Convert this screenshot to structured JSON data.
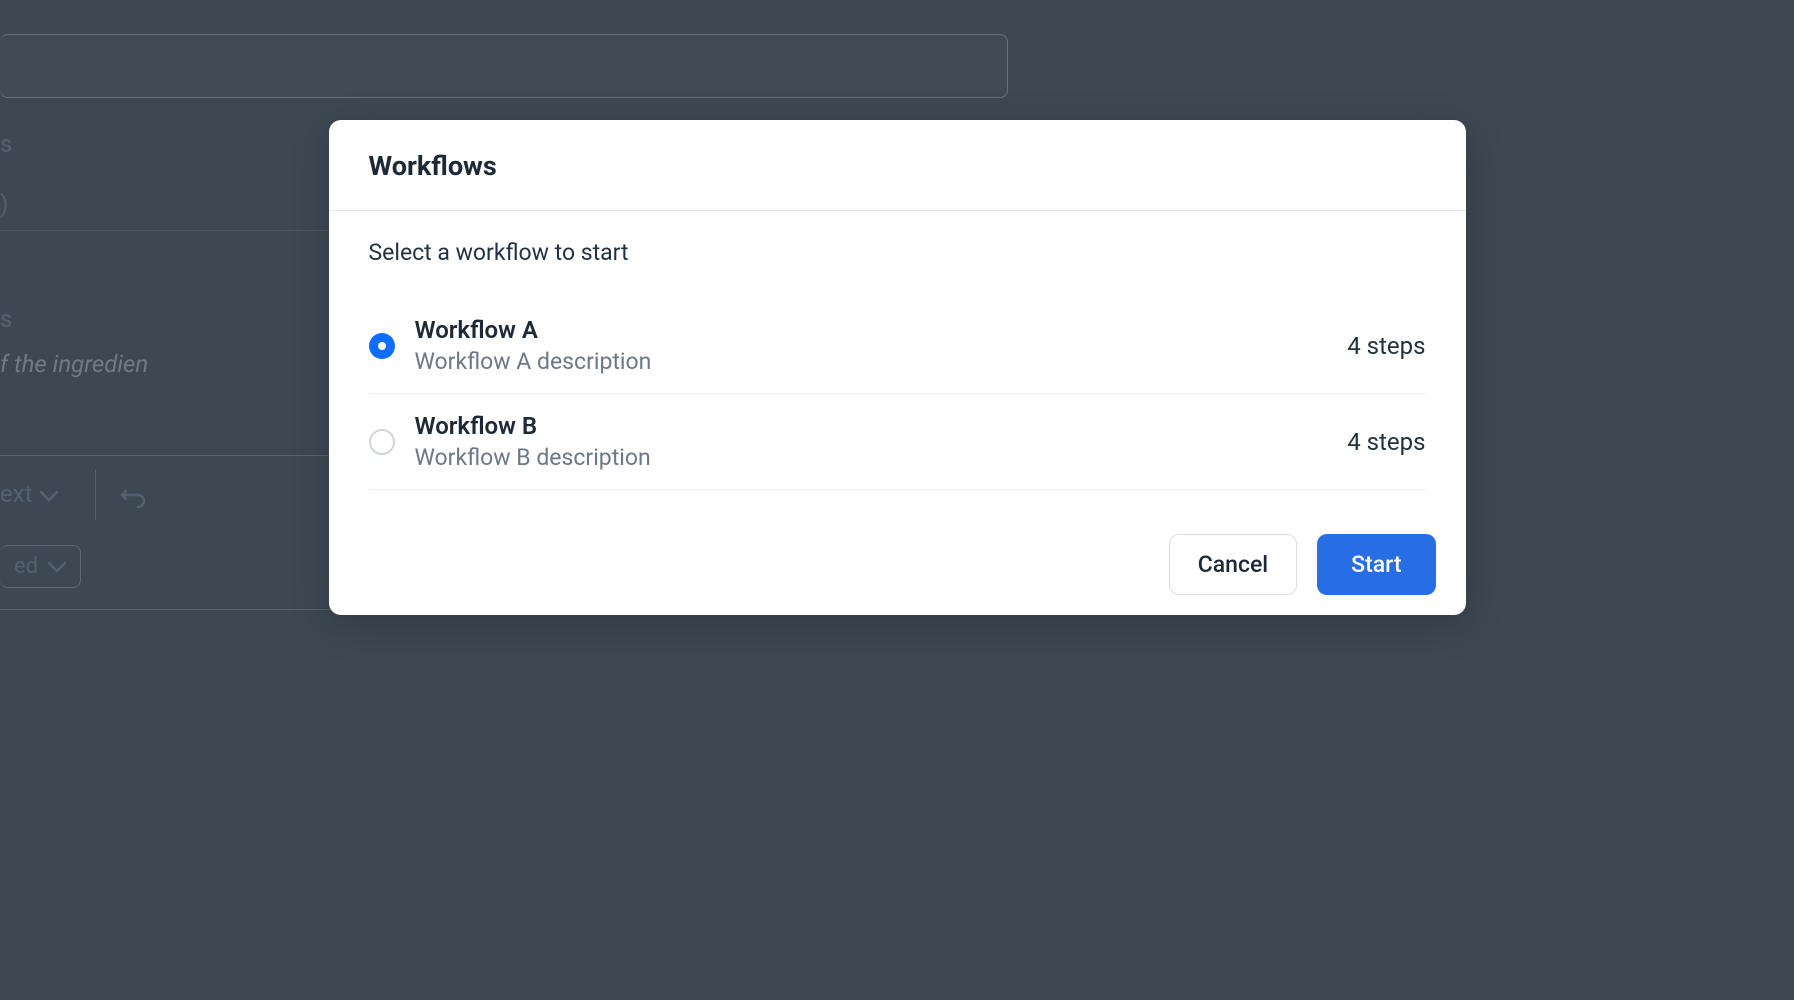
{
  "background": {
    "text1": "s",
    "text2": ")",
    "text3": "s",
    "text4": "f the ingredien",
    "toolbar_btn1": "ext",
    "toolbar_btn2": "ed"
  },
  "modal": {
    "title": "Workflows",
    "subtitle": "Select a workflow to start",
    "workflows": [
      {
        "name": "Workflow A",
        "description": "Workflow A description",
        "steps": "4 steps",
        "selected": true
      },
      {
        "name": "Workflow B",
        "description": "Workflow B description",
        "steps": "4 steps",
        "selected": false
      }
    ],
    "cancel_label": "Cancel",
    "start_label": "Start"
  }
}
